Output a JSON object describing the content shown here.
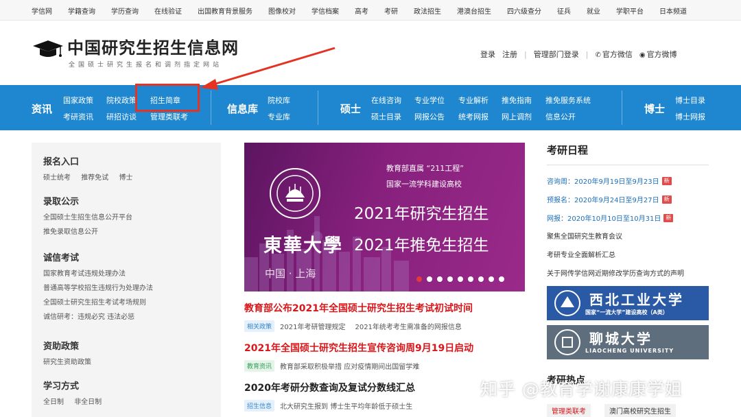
{
  "top_links": [
    "学信网",
    "学籍查询",
    "学历查询",
    "在线验证",
    "出国教育背景服务",
    "图像校对",
    "学信档案",
    "高考",
    "考研",
    "政法招生",
    "港澳台招生",
    "四六级查分",
    "征兵",
    "就业",
    "学职平台",
    "日本频道"
  ],
  "site": {
    "title": "中国研究生招生信息网",
    "subtitle": "全国硕士研究生报名和调剂指定网站"
  },
  "user_bar": {
    "login": "登录",
    "register": "注册",
    "admin_login": "管理部门登录",
    "wechat": "官方微信",
    "weibo": "官方微博"
  },
  "nav": {
    "zixun": {
      "head": "资讯",
      "links": [
        "国家政策",
        "院校政策",
        "招生简章",
        "考研资讯",
        "研招访谈",
        "管理类联考"
      ]
    },
    "xinxiku": {
      "head": "信息库",
      "links": [
        "院校库",
        "专业库"
      ]
    },
    "shuoshi": {
      "head": "硕士",
      "links": [
        "在线咨询",
        "专业学位",
        "专业解析",
        "推免指南",
        "推免服务系统",
        "硕士目录",
        "网报公告",
        "统考网报",
        "网上调剂",
        "信息公开"
      ]
    },
    "boshi": {
      "head": "博士",
      "links": [
        "博士目录",
        "博士网报"
      ]
    }
  },
  "sidebar": {
    "sections": [
      {
        "title": "报名入口",
        "inline": [
          "硕士统考",
          "推荐免试",
          "博士"
        ]
      },
      {
        "title": "录取公示",
        "lines": [
          "全国硕士生招生信息公开平台",
          "推免录取信息公开"
        ]
      },
      {
        "title": "诚信考试",
        "lines": [
          "国家教育考试违规处理办法",
          "普通高等学校招生违规行为处理办法",
          "全国硕士研究生招生考试考场规则",
          "诚信研考：违规必究 违法必惩"
        ]
      },
      {
        "title": "资助政策",
        "lines": [
          "研究生资助政策"
        ]
      },
      {
        "title": "学习方式",
        "inline": [
          "全日制",
          "非全日制"
        ]
      }
    ]
  },
  "banner": {
    "calligraphy": "東華大學",
    "location": "中国 · 上海",
    "line1": "教育部直属 “211工程”",
    "line2": "国家一流学科建设高校",
    "big1": "2021年研究生招生",
    "big2": "2021年推免生招生",
    "dots": 9,
    "active_dot": 0,
    "bg": "#87207d"
  },
  "news": [
    {
      "headline": "教育部公布2021年全国硕士研究生招生考试初试时间",
      "color": "red",
      "tag": "相关政策",
      "tag_style": "blue",
      "items": [
        "2021年考研管理规定",
        "2021年统考考生需准备的网报信息"
      ]
    },
    {
      "headline": "2021年全国硕士研究生招生宣传咨询周9月19日启动",
      "color": "red",
      "tag": "教育资讯",
      "tag_style": "green",
      "items": [
        "教育部采取积极举措 应对疫情期间出国留学难"
      ]
    },
    {
      "headline": "2020年考研分数查询及复试分数线汇总",
      "color": "dark",
      "tag": "招生信息",
      "tag_style": "blue",
      "items": [
        "北大研究生报到 博士生平均年龄低于硕士生"
      ]
    }
  ],
  "schedule": {
    "title": "考研日程",
    "new_badge": "新",
    "items": [
      {
        "text": "咨询周：2020年9月19日至9月23日",
        "style": "blue",
        "new": true
      },
      {
        "text": "预报名：2020年9月24日至9月27日",
        "style": "blue",
        "new": true
      },
      {
        "text": "网报：2020年10月10日至10月31日",
        "style": "blue",
        "new": true
      },
      {
        "text": "聚焦全国研究生教育会议",
        "style": "dark",
        "new": false
      },
      {
        "text": "考研专业全面解析汇总",
        "style": "dark",
        "new": false
      },
      {
        "text": "关于网传学信网近期修改学历查询方式的声明",
        "style": "dark",
        "new": false
      }
    ]
  },
  "uni_banners": [
    {
      "name": "西北工业大学",
      "tag": "国家“一流大学”建设高校（A类）",
      "color": "#2a5aa6"
    },
    {
      "name": "聊城大学",
      "tag": "LIAOCHENG UNIVERSITY",
      "color": "#5e6e7c"
    }
  ],
  "hot": {
    "title": "考研热点",
    "tags": [
      "管理类联考",
      "澳门高校研究生招生"
    ]
  },
  "watermark": "知乎 @教育学谢康康学姐",
  "colors": {
    "nav_blue": "#1e87d0",
    "annotation_red": "#e43323",
    "headline_red": "#d9161a"
  }
}
